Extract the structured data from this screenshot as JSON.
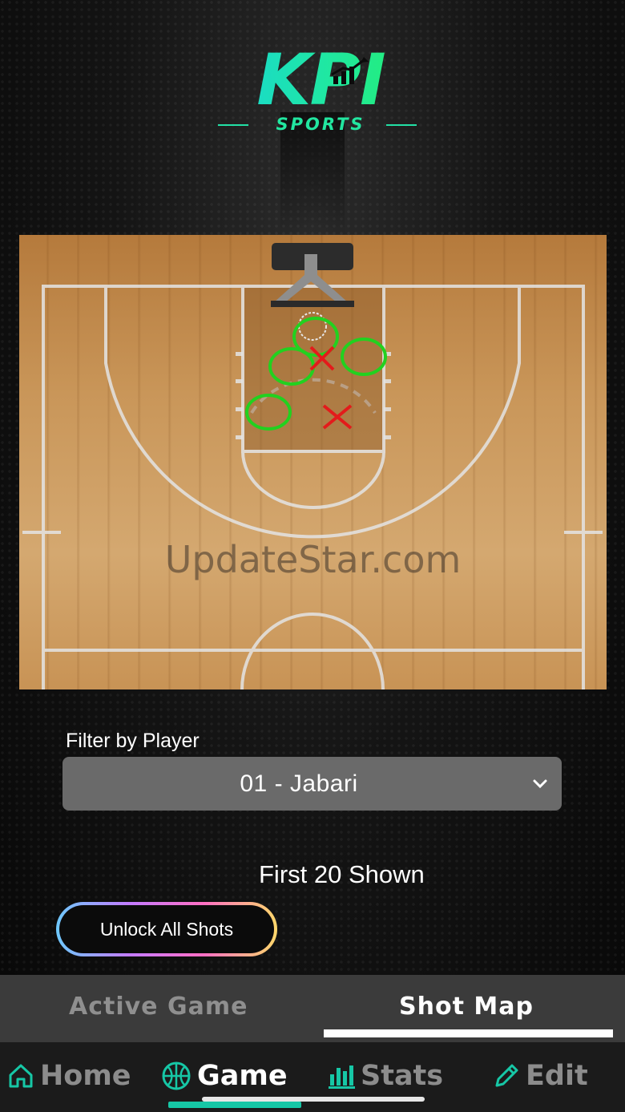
{
  "logo": {
    "main": "KPI",
    "sub": "SPORTS"
  },
  "court": {
    "watermark": "UpdateStar.com",
    "shots": [
      {
        "result": "made"
      },
      {
        "result": "made"
      },
      {
        "result": "made"
      },
      {
        "result": "made"
      },
      {
        "result": "missed"
      },
      {
        "result": "missed"
      }
    ],
    "colors": {
      "made": "#22d11f",
      "missed": "#e31b1b"
    }
  },
  "filter": {
    "label": "Filter by Player",
    "selected": "01 - Jabari"
  },
  "shown_text": "First 20 Shown",
  "unlock_button": "Unlock All Shots",
  "tabs": [
    {
      "label": "Active Game",
      "active": false
    },
    {
      "label": "Shot Map",
      "active": true
    }
  ],
  "nav": [
    {
      "label": "Home",
      "icon": "home-icon",
      "active": false
    },
    {
      "label": "Game",
      "icon": "basketball-icon",
      "active": true
    },
    {
      "label": "Stats",
      "icon": "bar-chart-icon",
      "active": false
    },
    {
      "label": "Edit",
      "icon": "pencil-icon",
      "active": false
    }
  ],
  "colors": {
    "accent": "#16c7a6",
    "logo_gradient_start": "#17d4d9",
    "logo_gradient_end": "#25f06a"
  }
}
